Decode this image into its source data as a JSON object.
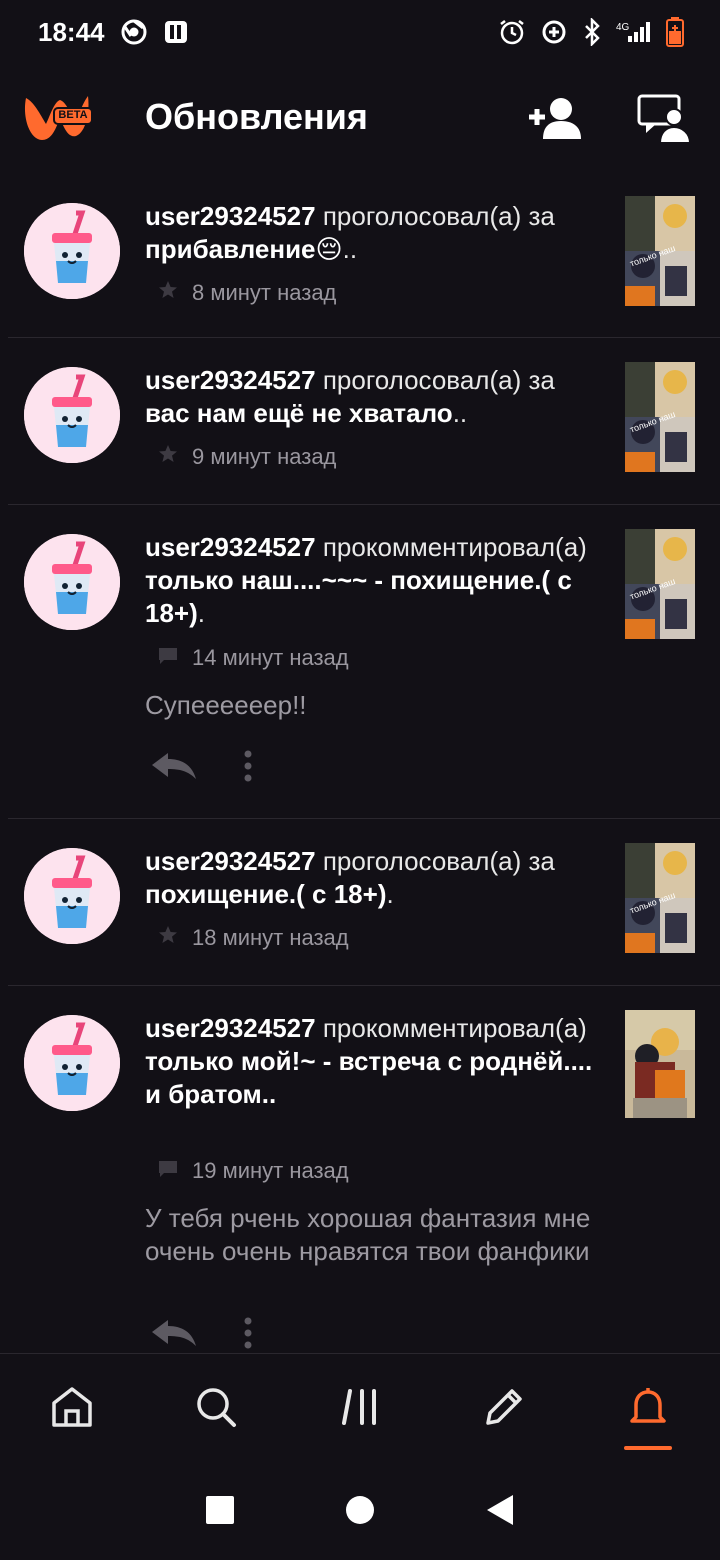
{
  "status": {
    "time": "18:44",
    "network": "4G"
  },
  "header": {
    "logo_badge": "BETA",
    "title": "Обновления"
  },
  "colors": {
    "background": "#121016",
    "accent": "#ff6a2e",
    "muted": "#9a979f"
  },
  "feed": [
    {
      "user": "user29324527",
      "action": " проголосовал(а) за ",
      "target": "прибавление😔",
      "suffix": "..",
      "meta_icon": "star-icon",
      "time": "8 минут назад"
    },
    {
      "user": "user29324527",
      "action": " проголосовал(а) за ",
      "target": "вас нам ещё не хватало",
      "suffix": "..",
      "meta_icon": "star-icon",
      "time": "9 минут назад"
    },
    {
      "user": "user29324527",
      "action": " прокомментировал(а) ",
      "target": "только наш....~~~ - похищение.( с 18+)",
      "suffix": ".",
      "meta_icon": "comment-icon",
      "time": "14 минут назад",
      "comment": "Супеееееер!!"
    },
    {
      "user": "user29324527",
      "action": " проголосовал(а) за ",
      "target": "похищение.( с 18+)",
      "suffix": ".",
      "meta_icon": "star-icon",
      "time": "18 минут назад"
    },
    {
      "user": "user29324527",
      "action": " прокомментировал(а) ",
      "target": "только мой!~ - встреча с роднёй.... и братом..",
      "suffix": "",
      "meta_icon": "comment-icon",
      "time": "19 минут назад",
      "comment": "У тебя рчень хорошая фантазия мне очень очень нравятся твои фанфики"
    }
  ],
  "nav": {
    "items": [
      "home",
      "search",
      "library",
      "write",
      "notifications"
    ],
    "active": "notifications"
  }
}
